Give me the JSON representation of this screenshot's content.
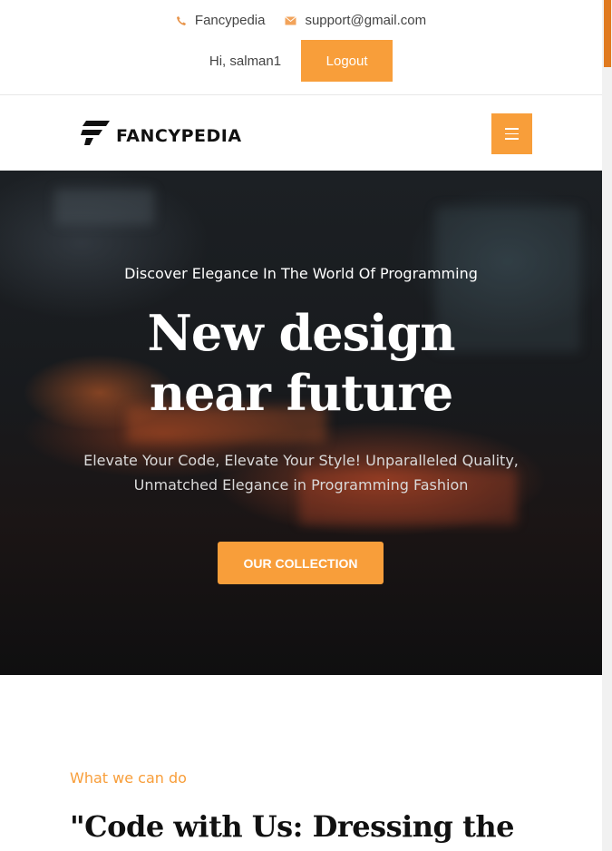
{
  "topbar": {
    "site_name": "Fancypedia",
    "email": "support@gmail.com",
    "greeting": "Hi, salman1",
    "logout_label": "Logout"
  },
  "navbar": {
    "logo_text": "FANCYPEDIA",
    "menu_icon": "hamburger-icon"
  },
  "hero": {
    "kicker": "Discover Elegance In The World Of Programming",
    "title_line1": "New design",
    "title_line2": "near future",
    "subtitle_line1": "Elevate Your Code, Elevate Your Style! Unparalleled Quality,",
    "subtitle_line2": "Unmatched Elegance in Programming Fashion",
    "cta_label": "OUR COLLECTION"
  },
  "section": {
    "kicker": "What we can do",
    "title": "\"Code with Us: Dressing the"
  },
  "colors": {
    "accent": "#f89e3a",
    "scroll_thumb": "#e07a1f"
  }
}
